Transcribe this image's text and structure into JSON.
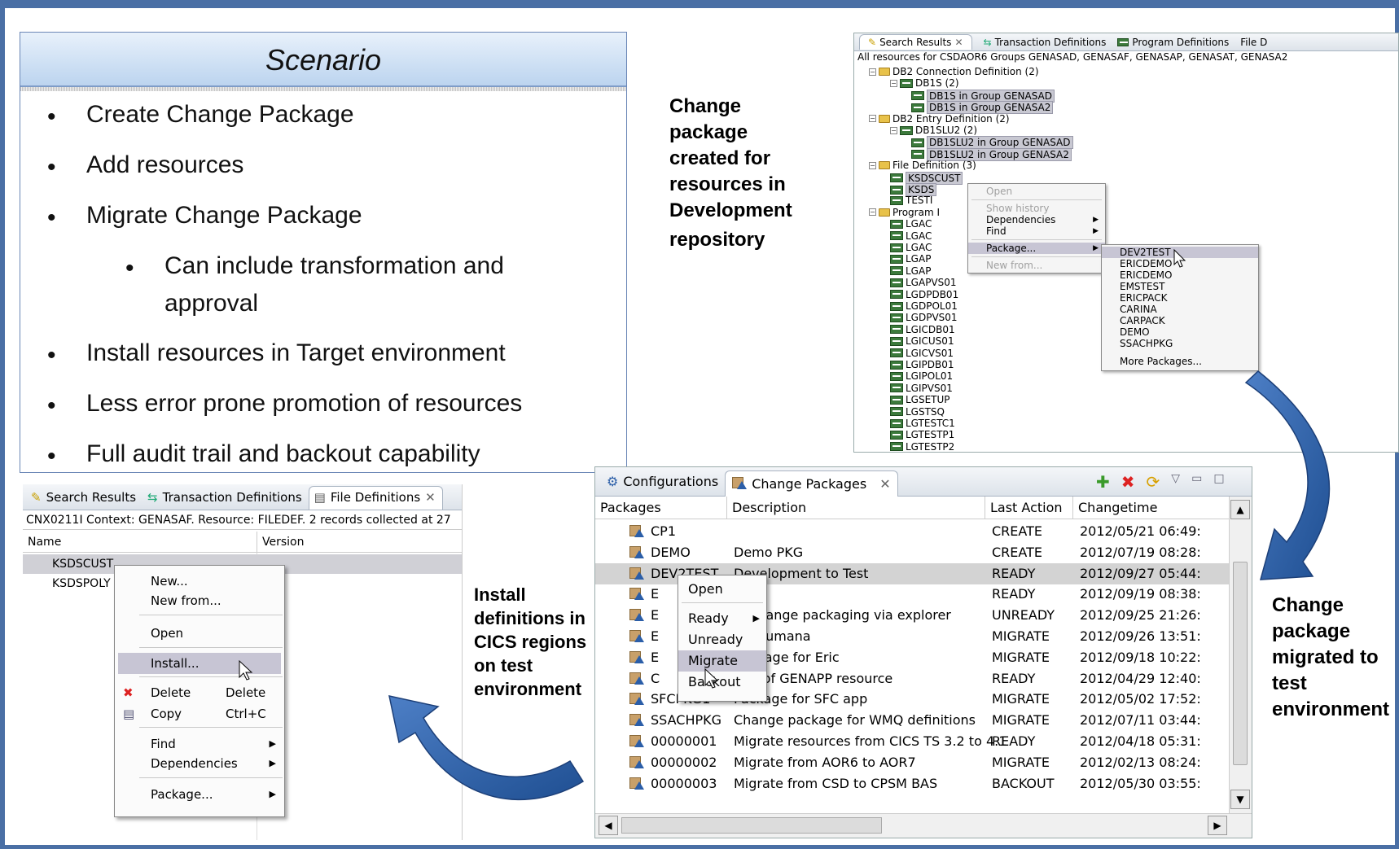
{
  "scenario": {
    "title": "Scenario",
    "bullets": [
      "Create Change Package",
      "Add resources",
      "Migrate Change Package",
      "Can include transformation and",
      "approval",
      "Install resources in Target environment",
      "Less error prone promotion of resources",
      "Full audit trail and backout capability"
    ]
  },
  "labels": {
    "created": [
      "Change",
      "package",
      "created for",
      "resources in",
      "Development",
      "repository"
    ],
    "install": [
      "Install",
      "definitions in",
      "CICS regions",
      "on test",
      "environment"
    ],
    "migrated": [
      "Change",
      "package",
      "migrated to",
      "test",
      "environment"
    ]
  },
  "explorer": {
    "tabs": [
      "Search Results",
      "Transaction Definitions",
      "Program Definitions",
      "File D"
    ],
    "header": "All resources for CSDAOR6 Groups GENASAD, GENASAF, GENASAP, GENASAT, GENASA2",
    "tree": [
      "DB2 Connection Definition (2)",
      "DB1S (2)",
      "DB1S in Group GENASAD",
      "DB1S in Group GENASA2",
      "DB2 Entry Definition (2)",
      "DB1SLU2 (2)",
      "DB1SLU2 in Group GENASAD",
      "DB1SLU2 in Group GENASA2",
      "File Definition (3)",
      "KSDSCUST",
      "KSDS",
      "TESTI",
      "Program I",
      "LGAC",
      "LGAC",
      "LGAC",
      "LGAP",
      "LGAP",
      "LGAPVS01",
      "LGDPDB01",
      "LGDPOL01",
      "LGDPVS01",
      "LGICDB01",
      "LGICUS01",
      "LGICVS01",
      "LGIPDB01",
      "LGIPOL01",
      "LGIPVS01",
      "LGSETUP",
      "LGSTSQ",
      "LGTESTC1",
      "LGTESTP1",
      "LGTESTP2"
    ],
    "menu": [
      "Open",
      "Show history",
      "Dependencies",
      "Find",
      "Package...",
      "New from..."
    ],
    "submenu": [
      "DEV2TEST",
      "ERICDEMO",
      "ERICDEMO",
      "EMSTEST",
      "ERICPACK",
      "CARINA",
      "CARPACK",
      "DEMO",
      "SSACHPKG",
      "More Packages..."
    ]
  },
  "filedefs": {
    "tabs": [
      "Search Results",
      "Transaction Definitions",
      "File Definitions"
    ],
    "context": "CNX0211I Context: GENASAF. Resource: FILEDEF. 2 records collected at 27",
    "columns": [
      "Name",
      "Version"
    ],
    "rows": [
      "KSDSCUST",
      "KSDSPOLY"
    ],
    "menu": {
      "new": "New...",
      "new_from": "New from...",
      "open": "Open",
      "install": "Install...",
      "delete": "Delete",
      "delete_key": "Delete",
      "copy": "Copy",
      "copy_key": "Ctrl+C",
      "find": "Find",
      "dependencies": "Dependencies",
      "package": "Package..."
    }
  },
  "packages": {
    "tabs": [
      "Configurations",
      "Change Packages"
    ],
    "columns": [
      "Packages",
      "Description",
      "Last Action",
      "Changetime"
    ],
    "rows": [
      {
        "name": "CP1",
        "desc": "",
        "action": "CREATE",
        "time": "2012/05/21 06:49:"
      },
      {
        "name": "DEMO",
        "desc": "Demo PKG",
        "action": "CREATE",
        "time": "2012/07/19 08:28:"
      },
      {
        "name": "DEV2TEST",
        "desc": "Development to Test",
        "action": "READY",
        "time": "2012/09/27 05:44:"
      },
      {
        "name": "E",
        "desc": "",
        "action": "READY",
        "time": "2012/09/19 08:38:"
      },
      {
        "name": "E",
        "desc": "of change packaging via explorer",
        "action": "UNREADY",
        "time": "2012/09/25 21:26:"
      },
      {
        "name": "E",
        "desc": "for Humana",
        "action": "MIGRATE",
        "time": "2012/09/26 13:51:"
      },
      {
        "name": "E",
        "desc": "package for Eric",
        "action": "MIGRATE",
        "time": "2012/09/18 10:22:"
      },
      {
        "name": "C",
        "desc": "tion of GENAPP resource",
        "action": "READY",
        "time": "2012/04/29 12:40:"
      },
      {
        "name": "SFCPKG1",
        "desc": "Package for SFC app",
        "action": "MIGRATE",
        "time": "2012/05/02 17:52:"
      },
      {
        "name": "SSACHPKG",
        "desc": "Change package for WMQ definitions",
        "action": "MIGRATE",
        "time": "2012/07/11 03:44:"
      },
      {
        "name": "00000001",
        "desc": "Migrate resources from CICS TS 3.2 to 4.1",
        "action": "READY",
        "time": "2012/04/18 05:31:"
      },
      {
        "name": "00000002",
        "desc": "Migrate from AOR6 to AOR7",
        "action": "MIGRATE",
        "time": "2012/02/13 08:24:"
      },
      {
        "name": "00000003",
        "desc": "Migrate from CSD to CPSM BAS",
        "action": "BACKOUT",
        "time": "2012/05/30 03:55:"
      }
    ],
    "menu": [
      "Open",
      "Ready",
      "Unready",
      "Migrate",
      "Backout"
    ]
  }
}
